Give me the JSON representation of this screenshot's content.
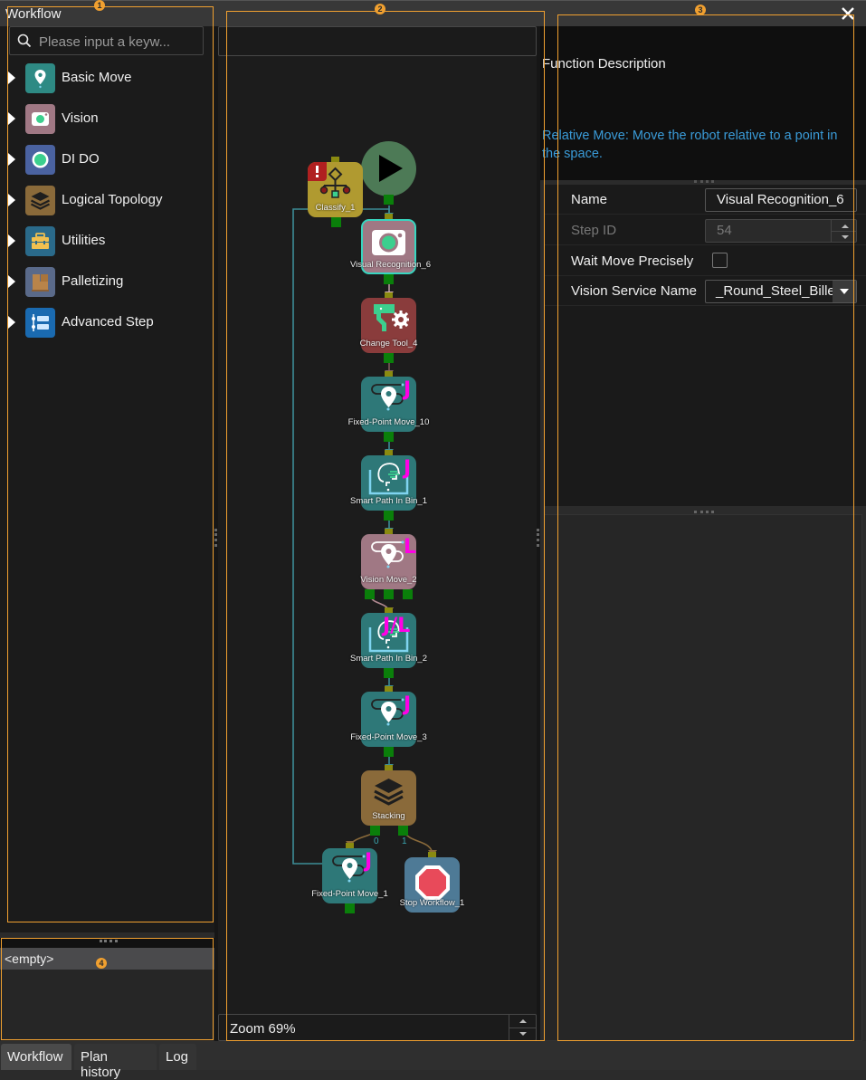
{
  "left_panel": {
    "title": "Workflow",
    "search_placeholder": "Please input a keyw...",
    "categories": [
      {
        "label": "Basic Move",
        "icon": "map-pin-icon",
        "color": "#2e8a84"
      },
      {
        "label": "Vision",
        "icon": "camera-icon",
        "color": "#a07884"
      },
      {
        "label": "DI DO",
        "icon": "io-signal-icon",
        "color": "#4a62a0"
      },
      {
        "label": "Logical Topology",
        "icon": "layers-icon",
        "color": "#8a6a3a"
      },
      {
        "label": "Utilities",
        "icon": "toolbox-icon",
        "color": "#2a6a8a"
      },
      {
        "label": "Palletizing",
        "icon": "pallet-icon",
        "color": "#5a6a8a"
      },
      {
        "label": "Advanced Step",
        "icon": "list-steps-icon",
        "color": "#1a6ab0"
      }
    ]
  },
  "bottom_left": {
    "row_text": "<empty>"
  },
  "bottom_tabs": [
    {
      "label": "Workflow",
      "active": true
    },
    {
      "label": "Plan history",
      "active": false
    },
    {
      "label": "Log",
      "active": false
    }
  ],
  "canvas": {
    "zoom_label": "Zoom 69%",
    "nodes": [
      {
        "id": "start",
        "label": "",
        "type": "start"
      },
      {
        "id": "classify",
        "label": "Classify_1",
        "type": "classify",
        "warning": true
      },
      {
        "id": "vis6",
        "label": "Visual Recognition_6",
        "type": "vision",
        "selected": true
      },
      {
        "id": "tool4",
        "label": "Change Tool_4",
        "type": "change-tool"
      },
      {
        "id": "fpm10",
        "label": "Fixed-Point Move_10",
        "type": "fixed-point",
        "badge": "J"
      },
      {
        "id": "spb1",
        "label": "Smart Path In Bin_1",
        "type": "smart-path",
        "badge": "J"
      },
      {
        "id": "vm2",
        "label": "Vision Move_2",
        "type": "vision-move",
        "badge": "L"
      },
      {
        "id": "spb2",
        "label": "Smart Path In Bin_2",
        "type": "smart-path",
        "badge": "J/L"
      },
      {
        "id": "fpm3",
        "label": "Fixed-Point Move_3",
        "type": "fixed-point",
        "badge": "J"
      },
      {
        "id": "stack",
        "label": "Stacking",
        "type": "stacking",
        "ports": [
          "0",
          "1"
        ]
      },
      {
        "id": "fpm1",
        "label": "Fixed-Point Move_1",
        "type": "fixed-point",
        "badge": "J"
      },
      {
        "id": "stop1",
        "label": "Stop Workflow_1",
        "type": "stop"
      }
    ]
  },
  "right_panel": {
    "desc_title": "Function Description",
    "desc_text": "Relative Move: Move the robot relative to a point in the space.",
    "properties": [
      {
        "label": "Name",
        "value": "Visual Recognition_6",
        "type": "text",
        "enabled": true
      },
      {
        "label": "Step ID",
        "value": "54",
        "type": "spin",
        "enabled": false
      },
      {
        "label": "Wait Move Precisely",
        "value": false,
        "type": "checkbox",
        "enabled": true
      },
      {
        "label": "Vision Service Name",
        "value": "_Round_Steel_Billet",
        "type": "dropdown",
        "enabled": true
      }
    ]
  },
  "annotations": [
    "1",
    "2",
    "3",
    "4"
  ]
}
